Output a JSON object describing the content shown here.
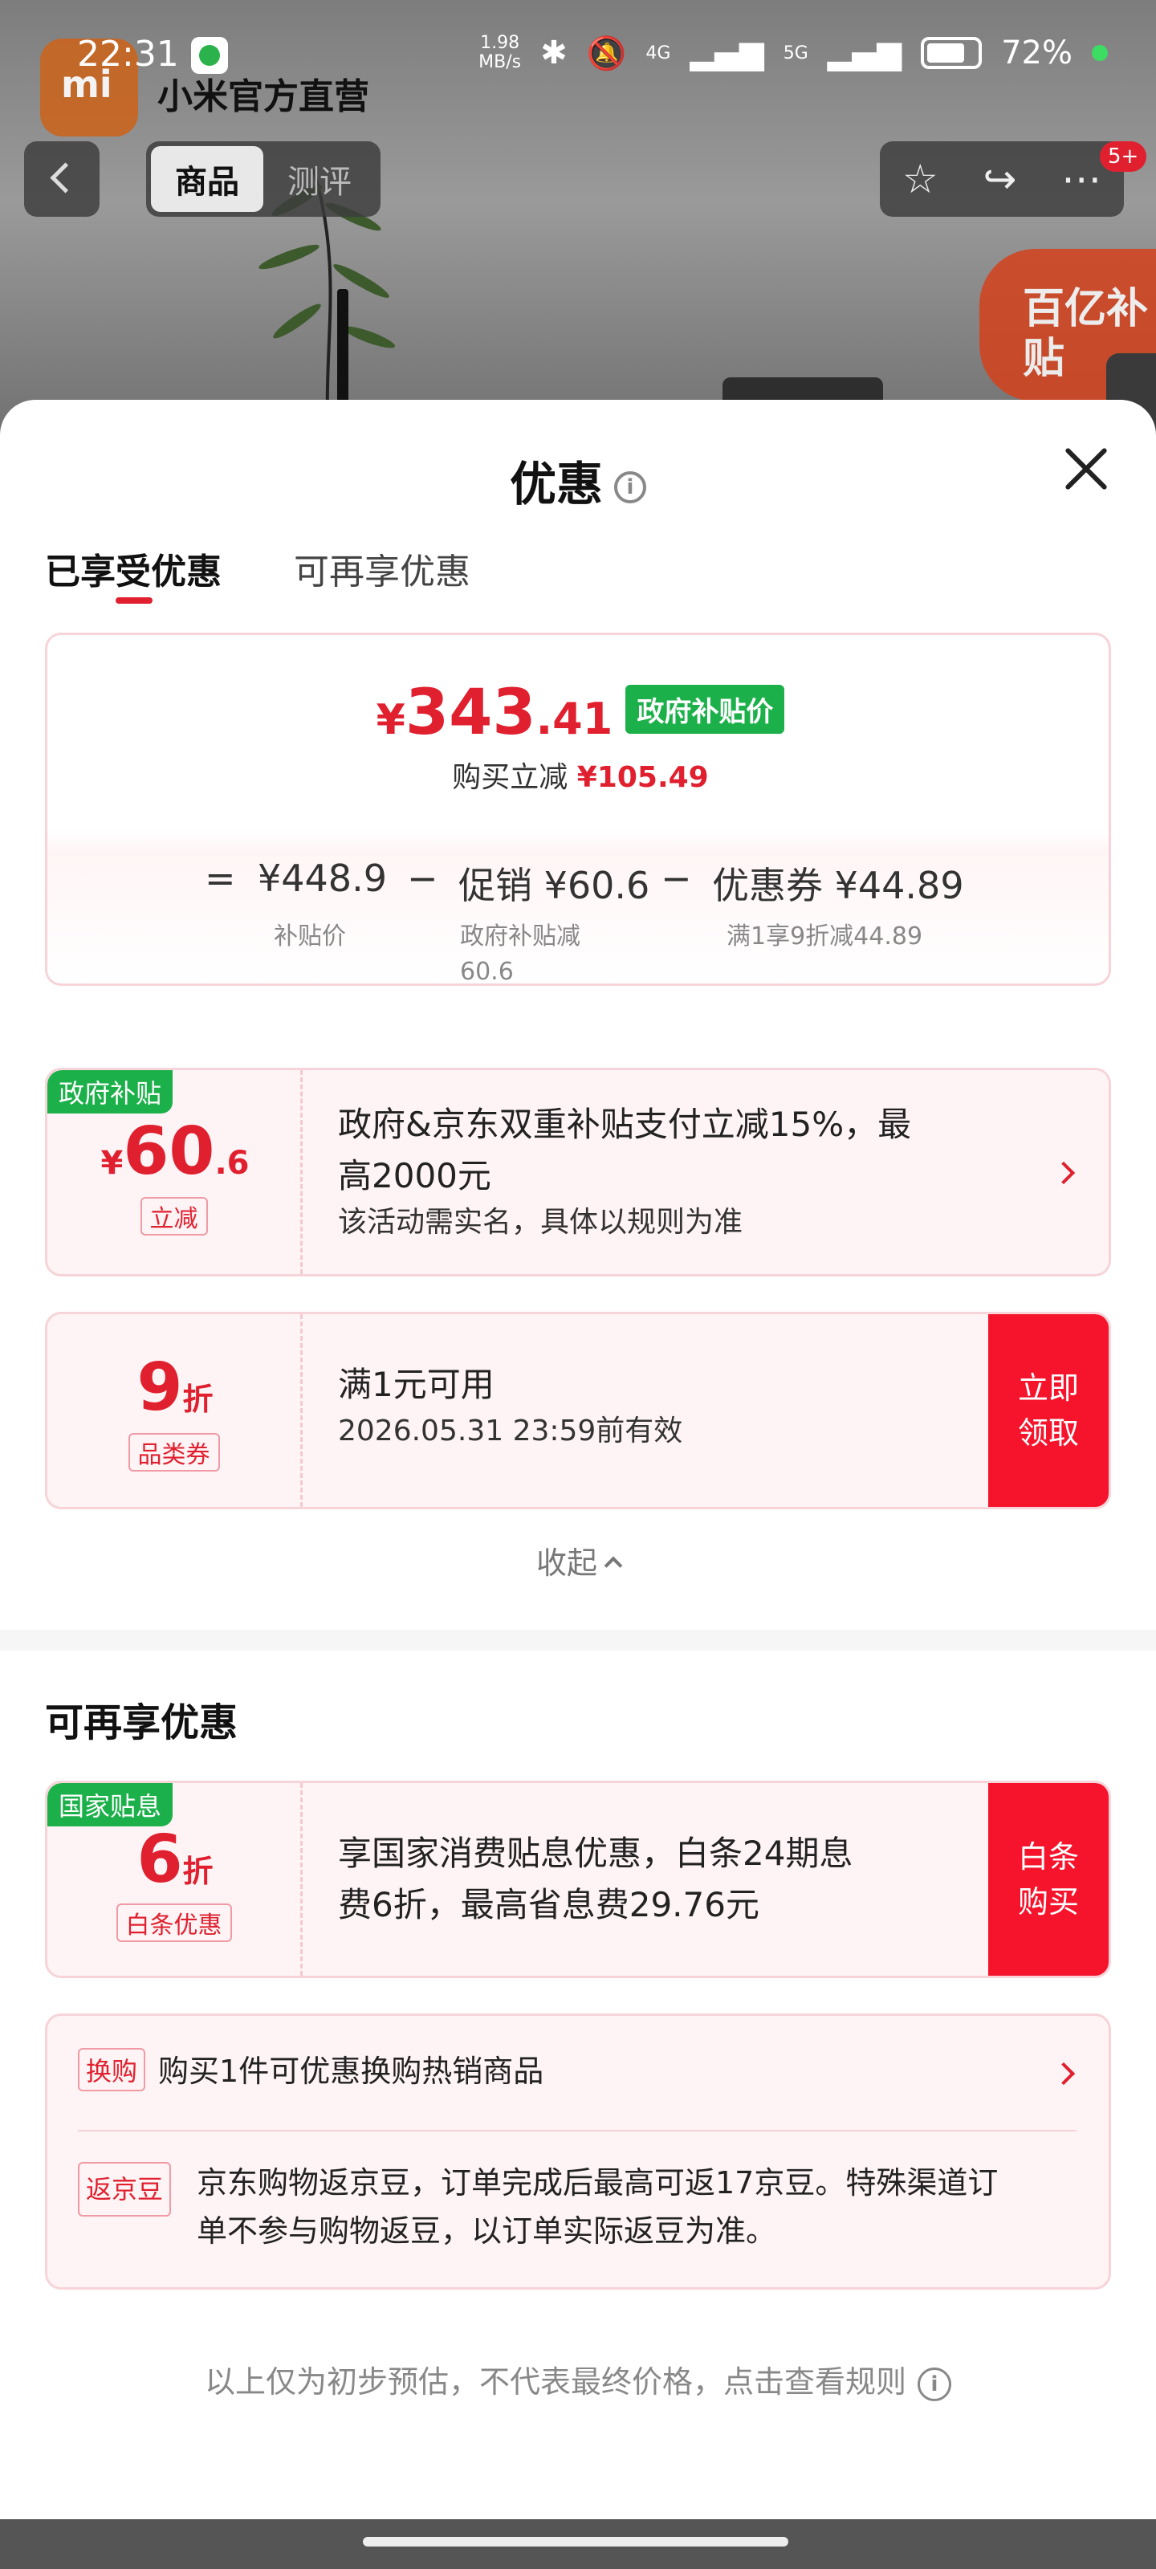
{
  "status_bar": {
    "time": "22:31",
    "net_speed_value": "1.98",
    "net_speed_unit": "MB/s",
    "signal_1": "4G",
    "signal_2": "5G",
    "battery": "72%"
  },
  "background": {
    "store_name": "小米官方直营",
    "logo_text": "mi",
    "tabs": [
      "商品",
      "测评"
    ],
    "notification_badge": "5+",
    "promo_badge": "百亿补贴"
  },
  "sheet": {
    "title": "优惠",
    "tabs": [
      "已享受优惠",
      "可再享优惠"
    ],
    "summary": {
      "currency": "¥",
      "price_int": "343",
      "price_dec": ".41",
      "tag": "政府补贴价",
      "instant_label": "购买立减",
      "instant_amount": "¥105.49",
      "eq": "=",
      "minus": "−",
      "base_price": "¥448.9",
      "base_label": "补贴价",
      "promo_label": "促销",
      "promo_amount": "¥60.6",
      "promo_sub_1": "政府补贴减",
      "promo_sub_2": "60.6",
      "coupon_label": "优惠券",
      "coupon_amount": "¥44.89",
      "coupon_sub": "满1享9折减44.89"
    },
    "gov_subsidy": {
      "tag": "政府补贴",
      "currency": "¥",
      "amount_int": "60",
      "amount_dec": ".6",
      "label": "立减",
      "line1": "政府&京东双重补贴支付立减15%，最",
      "line2": "高2000元",
      "note": "该活动需实名，具体以规则为准"
    },
    "coupon": {
      "value": "9",
      "unit": "折",
      "label": "品类券",
      "line1": "满1元可用",
      "line2": "2026.05.31 23:59前有效",
      "button": [
        "立即",
        "领取"
      ]
    },
    "collapse_label": "收起",
    "more_section_title": "可再享优惠",
    "baitiao": {
      "tag": "国家贴息",
      "value": "6",
      "unit": "折",
      "label": "白条优惠",
      "line1": "享国家消费贴息优惠，白条24期息",
      "line2": "费6折，最高省息费29.76元",
      "button": [
        "白条",
        "购买"
      ]
    },
    "exchange": {
      "tag": "换购",
      "text": "购买1件可优惠换购热销商品"
    },
    "jingdou": {
      "tag": "返京豆",
      "line1": "京东购物返京豆，订单完成后最高可返17京豆。特殊渠道订",
      "line2": "单不参与购物返豆，以订单实际返豆为准。"
    },
    "footnote": "以上仅为初步预估，不代表最终价格，点击查看规则"
  },
  "colors": {
    "accent_red": "#e0202f",
    "green_tag": "#1cb04a",
    "claim_red": "#f5142c"
  }
}
